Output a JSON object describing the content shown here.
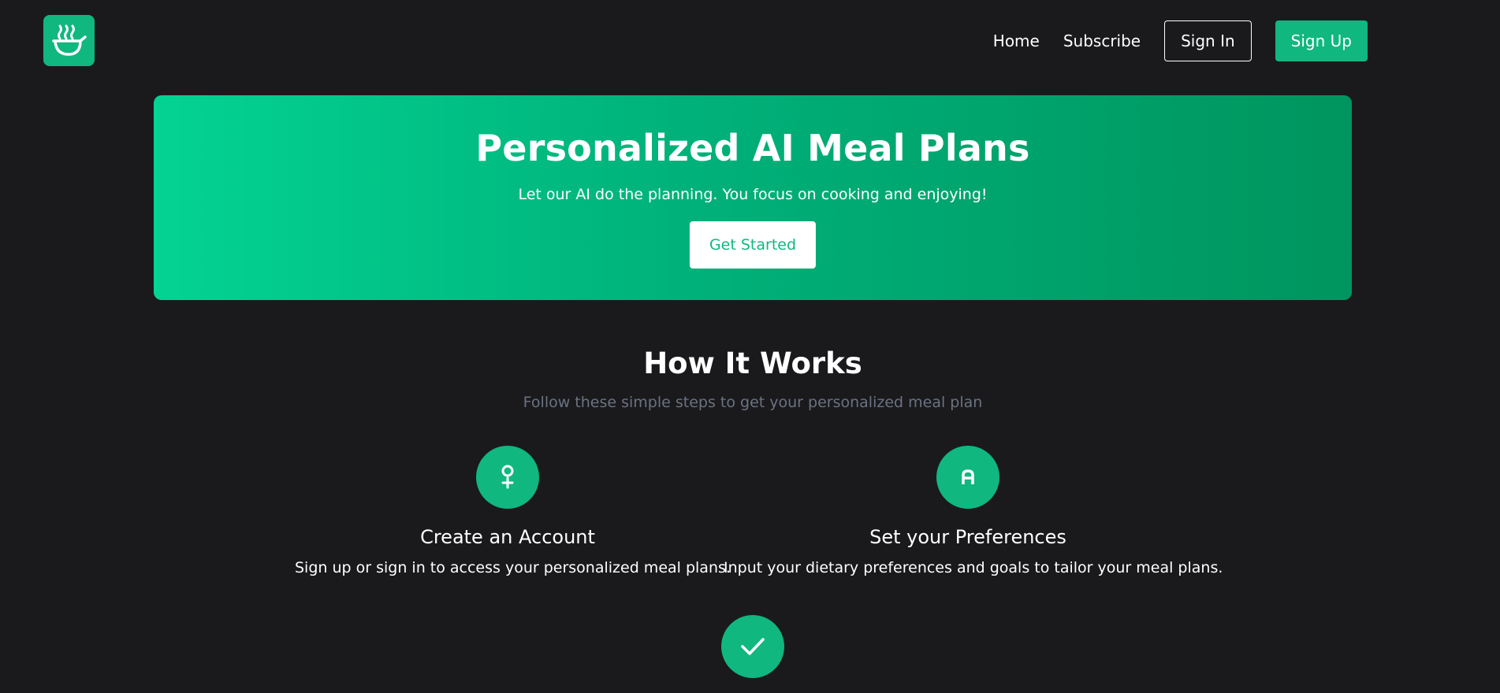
{
  "header": {
    "logo_icon": "bowl-steam-icon",
    "nav": {
      "home": "Home",
      "subscribe": "Subscribe",
      "sign_in": "Sign In",
      "sign_up": "Sign Up"
    }
  },
  "hero": {
    "title": "Personalized AI Meal Plans",
    "subtitle": "Let our AI do the planning. You focus on cooking and enjoying!",
    "cta": "Get Started"
  },
  "how_it_works": {
    "title": "How It Works",
    "subtitle": "Follow these simple steps to get your personalized meal plan",
    "steps": [
      {
        "icon": "user-add-icon",
        "title": "Create an Account",
        "description": "Sign up or sign in to access your personalized meal plans."
      },
      {
        "icon": "preferences-icon",
        "title": "Set your Preferences",
        "description": "Input your dietary preferences and goals to tailor your meal plans."
      },
      {
        "icon": "check-icon"
      }
    ]
  },
  "colors": {
    "background": "#1a1a1d",
    "accent": "#10b77f",
    "muted_text": "#6b7280"
  }
}
